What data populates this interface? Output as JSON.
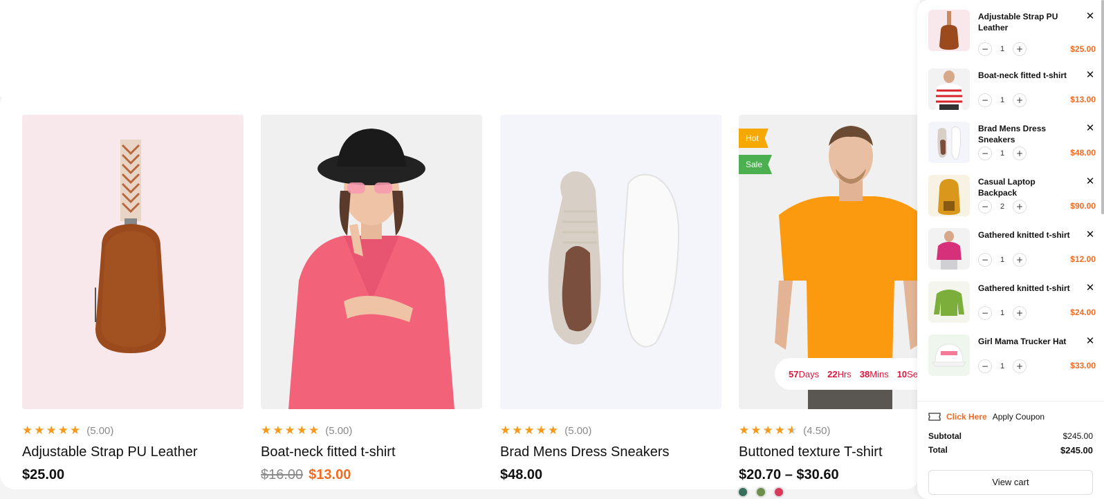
{
  "products": [
    {
      "name": "Adjustable Strap PU Leather",
      "rating": "(5.00)",
      "stars": "★★★★★",
      "price": "$25.00",
      "old_price": "",
      "sale_price": "",
      "bg": "#f8e8ec"
    },
    {
      "name": "Boat-neck fitted t-shirt",
      "rating": "(5.00)",
      "stars": "★★★★★",
      "price": "",
      "old_price": "$16.00",
      "sale_price": "$13.00",
      "bg": "#f0f0f0"
    },
    {
      "name": "Brad Mens Dress Sneakers",
      "rating": "(5.00)",
      "stars": "★★★★★",
      "price": "$48.00",
      "old_price": "",
      "sale_price": "",
      "bg": "#f4f5fa"
    },
    {
      "name": "Buttoned texture T-shirt",
      "rating": "(4.50)",
      "stars": "★★★★",
      "price": "$20.70 – $30.60",
      "old_price": "",
      "sale_price": "",
      "bg": "#f0f0f0",
      "badges": {
        "hot": "Hot",
        "sale": "Sale"
      },
      "countdown": {
        "days": "57",
        "days_label": "Days",
        "hrs": "22",
        "hrs_label": "Hrs",
        "mins": "38",
        "mins_label": "Mins",
        "secs": "10",
        "secs_label": "Sec"
      }
    }
  ],
  "cart": {
    "items": [
      {
        "title": "Adjustable Strap PU Leather",
        "qty": "1",
        "price": "$25.00",
        "thumb_bg": "#f8e8ec"
      },
      {
        "title": "Boat-neck fitted t-shirt",
        "qty": "1",
        "price": "$13.00",
        "thumb_bg": "#f2f2f2"
      },
      {
        "title": "Brad Mens Dress Sneakers",
        "qty": "1",
        "price": "$48.00",
        "thumb_bg": "#f4f5fa"
      },
      {
        "title": "Casual Laptop Backpack",
        "qty": "2",
        "price": "$90.00",
        "thumb_bg": "#f7f2e4"
      },
      {
        "title": "Gathered knitted t-shirt",
        "qty": "1",
        "price": "$12.00",
        "thumb_bg": "#f2f2f2"
      },
      {
        "title": "Gathered knitted t-shirt",
        "qty": "1",
        "price": "$24.00",
        "thumb_bg": "#f4f6ee"
      },
      {
        "title": "Girl Mama Trucker Hat",
        "qty": "1",
        "price": "$33.00",
        "thumb_bg": "#eef6ee"
      }
    ],
    "coupon_link": "Click Here",
    "coupon_text": "Apply Coupon",
    "subtotal_label": "Subtotal",
    "subtotal": "$245.00",
    "total_label": "Total",
    "total": "$245.00",
    "view_cart": "View cart"
  },
  "colors": {
    "accent": "#f26b21",
    "star": "#f59a1b",
    "countdown": "#e0113a",
    "hot": "#f5a900",
    "sale": "#4caf50"
  }
}
